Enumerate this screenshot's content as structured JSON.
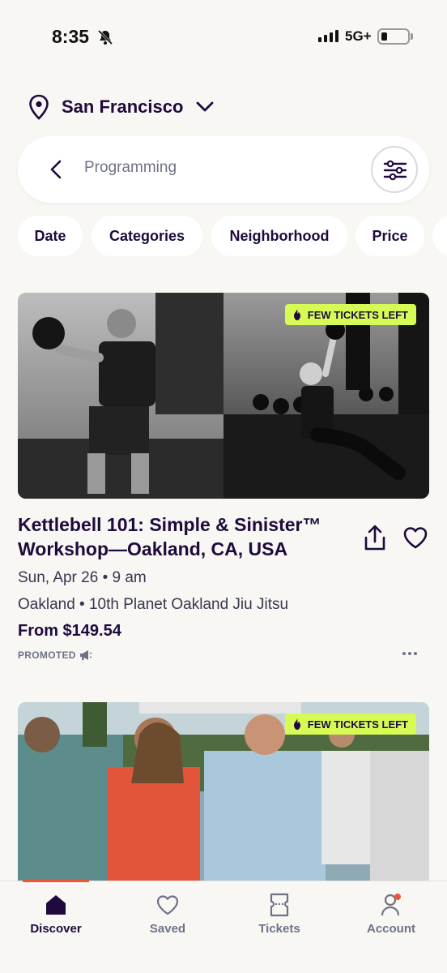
{
  "status_bar": {
    "time": "8:35",
    "network": "5G+",
    "battery_level": 0.2
  },
  "location": {
    "city": "San Francisco"
  },
  "search": {
    "value": "Programming"
  },
  "chips": [
    {
      "label": "Date"
    },
    {
      "label": "Categories"
    },
    {
      "label": "Neighborhood"
    },
    {
      "label": "Price"
    }
  ],
  "events": [
    {
      "badge": "FEW TICKETS LEFT",
      "title": "Kettlebell 101: Simple & Sinister™ Workshop—Oakland, CA, USA",
      "date": "Sun, Apr 26 • 9 am",
      "venue": "Oakland • 10th Planet Oakland Jiu Jitsu",
      "price": "From $149.54",
      "promoted": "PROMOTED"
    },
    {
      "badge": "FEW TICKETS LEFT"
    }
  ],
  "tabbar": {
    "tabs": [
      {
        "label": "Discover",
        "icon": "home-icon",
        "active": true
      },
      {
        "label": "Saved",
        "icon": "heart-icon"
      },
      {
        "label": "Tickets",
        "icon": "ticket-icon"
      },
      {
        "label": "Account",
        "icon": "person-icon"
      }
    ]
  },
  "colors": {
    "brand": "#f05537",
    "badge": "#d6fb55",
    "text_primary": "#1e0a3c",
    "text_secondary": "#6f7287",
    "background": "#f8f7f4"
  }
}
